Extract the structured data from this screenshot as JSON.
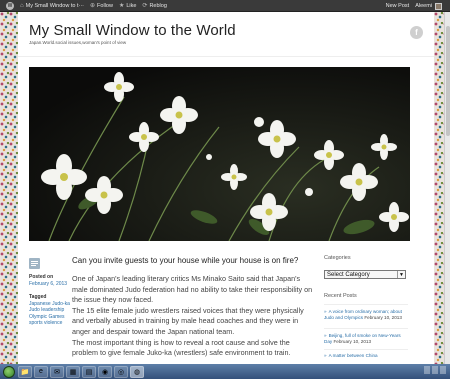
{
  "adminbar": {
    "wp_logo": "W",
    "site_tab": "My Small Window to t···",
    "follow": "Follow",
    "like": "Like",
    "reblog": "Reblog",
    "new_post": "New Post",
    "user": "Aleemi"
  },
  "site": {
    "title": "My Small Window to the World",
    "description": "Japan.World.social issues,woman's point of view",
    "social_icon": "f"
  },
  "post": {
    "title": "Can you invite guests to your house while your house is on fire?",
    "posted_on_label": "Posted on",
    "date": "February 6, 2013",
    "tagged_label": "Tagged",
    "tags": [
      "Japanese Judo-ka",
      "Judo leadership",
      "Olympic Games",
      "sports violence"
    ],
    "paragraphs": [
      "One of Japan's leading literary critics Ms Minako Saito said that Japan's male dominated Judo federation had no ability to take their responsibility on the issue they now faced.",
      "The 15 elite female judo wrestlers raised voices that they were physically and verbally abused in training by male head coaches and they were in anger and despair toward the Japan national team.",
      "The most important thing is how to reveal a root cause and solve the problem to give female Juko-ka (wrestlers) safe environment to train."
    ]
  },
  "sidebar": {
    "categories_heading": "Categories",
    "select_value": "Select Category",
    "recent_heading": "Recent Posts",
    "recent": [
      {
        "title": "A voice from ordinary woman; about Judo and Olympics",
        "date": "February 10, 2013"
      },
      {
        "title": "Beijing, full of smoke on New-Years Day",
        "date": "February 10, 2013"
      },
      {
        "title": "A matter between China",
        "date": ""
      }
    ]
  },
  "taskbar": {
    "buttons": [
      "folder",
      "ie",
      "mail",
      "calc",
      "explorer",
      "media",
      "browser",
      "chrome"
    ]
  },
  "colors": {
    "link": "#2a6fa8",
    "adminbar": "#3a3a3a"
  }
}
